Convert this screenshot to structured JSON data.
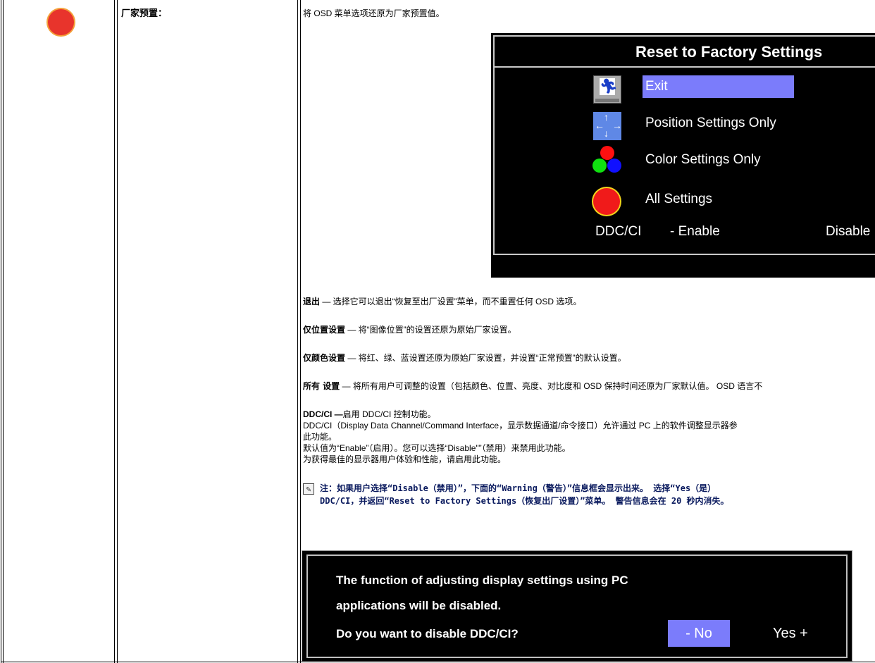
{
  "left_column": {
    "icon": "all-settings-circle-icon"
  },
  "section_title": "厂家预置：",
  "intro": "将 OSD 菜单选项还原为厂家预置值。",
  "osd": {
    "title": "Reset to Factory Settings",
    "items": [
      {
        "label": "Exit",
        "icon": "exit-icon",
        "selected": true
      },
      {
        "label": "Position Settings Only",
        "icon": "position-arrows-icon"
      },
      {
        "label": "Color Settings Only",
        "icon": "rgb-circles-icon"
      },
      {
        "label": "All Settings",
        "icon": "red-circle-icon"
      }
    ],
    "ddc_label": "DDC/CI",
    "ddc_enable": "- Enable",
    "ddc_disable": "Disable",
    "selected_color": "#7b7cfb"
  },
  "descriptions": [
    {
      "term": "退出",
      "text": " — 选择它可以退出“恢复至出厂设置”菜单，而不重置任何 OSD 选项。"
    },
    {
      "term": "仅位置设置",
      "text": " — 将“图像位置”的设置还原为原始厂家设置。"
    },
    {
      "term": "仅颜色设置",
      "text": " — 将红、绿、蓝设置还原为原始厂家设置，并设置“正常预置”的默认设置。"
    },
    {
      "term": "所有 设置",
      "text": " — 将所有用户可调整的设置（包括颜色、位置、亮度、对比度和 OSD 保持时间还原为厂家默认值。 OSD 语言不"
    }
  ],
  "ddc": {
    "term": "DDC/CI —",
    "text": "启用 DDC/CI 控制功能。",
    "line2": "DDC/CI（Display Data Channel/Command Interface，显示数据通道/命令接口）允许通过 PC 上的软件调整显示器参",
    "line3": "此功能。",
    "line4": "默认值为“Enable”（启用）。您可以选择“Disable\"”（禁用）来禁用此功能。",
    "line5": "为获得最佳的显示器用户体验和性能，请启用此功能。"
  },
  "note": {
    "line1": "注：如果用户选择“Disable（禁用）”，下面的“Warning（警告）”信息框会显示出来。 选择“Yes（是）",
    "line2": "DDC/CI，并返回“Reset to Factory Settings（恢复出厂设置）”菜单。 警告信息会在 20 秒内消失。"
  },
  "warning": {
    "line1": "The function of adjusting display settings using PC",
    "line2": "applications will be disabled.",
    "line3": "Do you want to disable DDC/CI?",
    "no_label": "- No",
    "yes_label": "Yes +"
  }
}
